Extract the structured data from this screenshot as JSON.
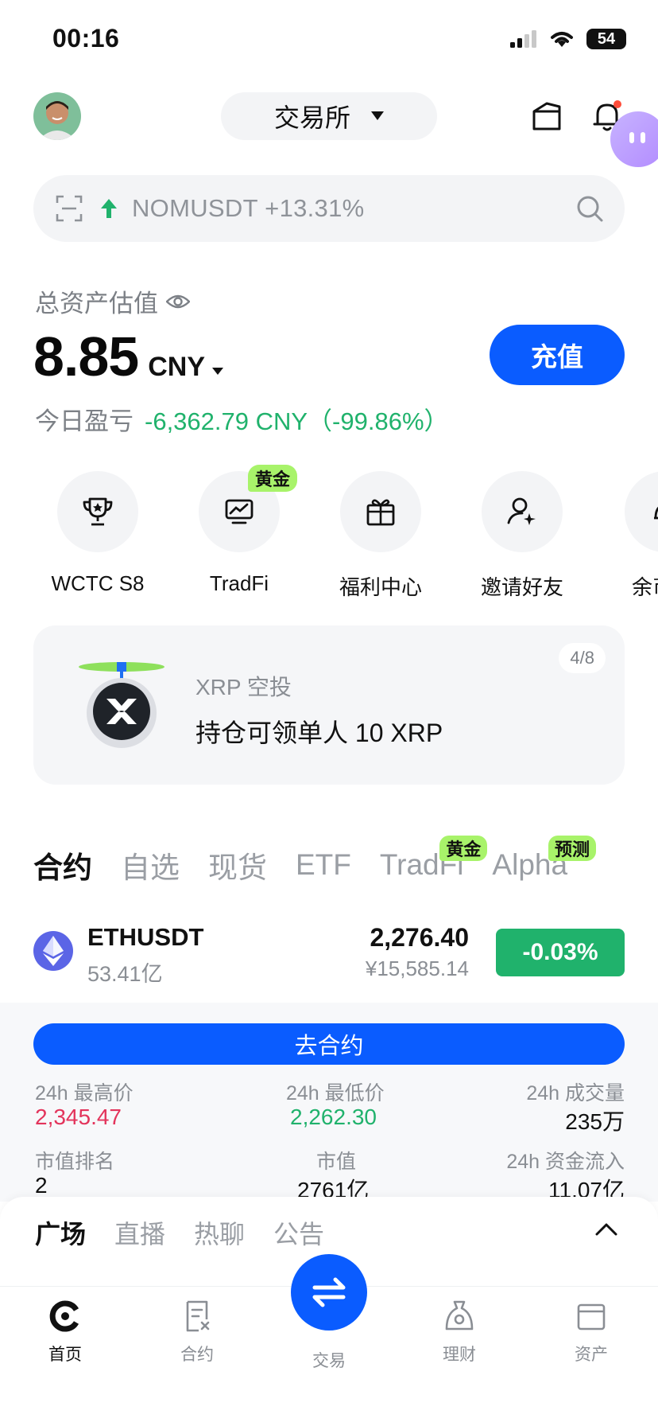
{
  "status_bar": {
    "time": "00:16",
    "battery": "54"
  },
  "header": {
    "exchange_label": "交易所"
  },
  "search": {
    "trending_text": "NOMUSDT +13.31%"
  },
  "assets": {
    "label": "总资产估值",
    "value": "8.85",
    "currency": "CNY",
    "deposit_label": "充值",
    "pnl_label": "今日盈亏",
    "pnl_value": "-6,362.79 CNY（-99.86%）"
  },
  "shortcuts": [
    {
      "label": "WCTC S8",
      "icon": "trophy-icon"
    },
    {
      "label": "TradFi",
      "icon": "chart-monitor-icon",
      "tag": "黄金"
    },
    {
      "label": "福利中心",
      "icon": "gift-icon"
    },
    {
      "label": "邀请好友",
      "icon": "invite-user-icon"
    },
    {
      "label": "余币",
      "icon": "savings-icon"
    }
  ],
  "airdrop": {
    "subtitle": "XRP 空投",
    "title": "持仓可领单人 10 XRP",
    "page": "4/8"
  },
  "market_tabs": [
    {
      "label": "合约",
      "active": true
    },
    {
      "label": "自选"
    },
    {
      "label": "现货"
    },
    {
      "label": "ETF"
    },
    {
      "label": "TradFi",
      "tag": "黄金"
    },
    {
      "label": "Alpha",
      "tag": "预测"
    }
  ],
  "ticker": {
    "symbol": "ETHUSDT",
    "volume": "53.41亿",
    "price": "2,276.40",
    "price_cny": "¥15,585.14",
    "change": "-0.03%",
    "change_color": "#20b26c"
  },
  "detail": {
    "button": "去合约",
    "high_label": "24h 最高价",
    "high": "2,345.47",
    "low_label": "24h 最低价",
    "low": "2,262.30",
    "volume_label": "24h 成交量",
    "volume": "235万",
    "rank_label": "市值排名",
    "rank": "2",
    "mcap_label": "市值",
    "mcap": "2761亿",
    "inflow_label": "24h 资金流入",
    "inflow": "11.07亿"
  },
  "feed_tabs": [
    {
      "label": "广场",
      "active": true
    },
    {
      "label": "直播"
    },
    {
      "label": "热聊"
    },
    {
      "label": "公告"
    }
  ],
  "tab_bar": [
    {
      "label": "首页",
      "active": true
    },
    {
      "label": "合约"
    },
    {
      "label": "交易"
    },
    {
      "label": "理财"
    },
    {
      "label": "资产"
    }
  ],
  "colors": {
    "accent": "#0a5cff",
    "up": "#20b26c",
    "down": "#e3345b",
    "tag": "#a8f36a"
  }
}
